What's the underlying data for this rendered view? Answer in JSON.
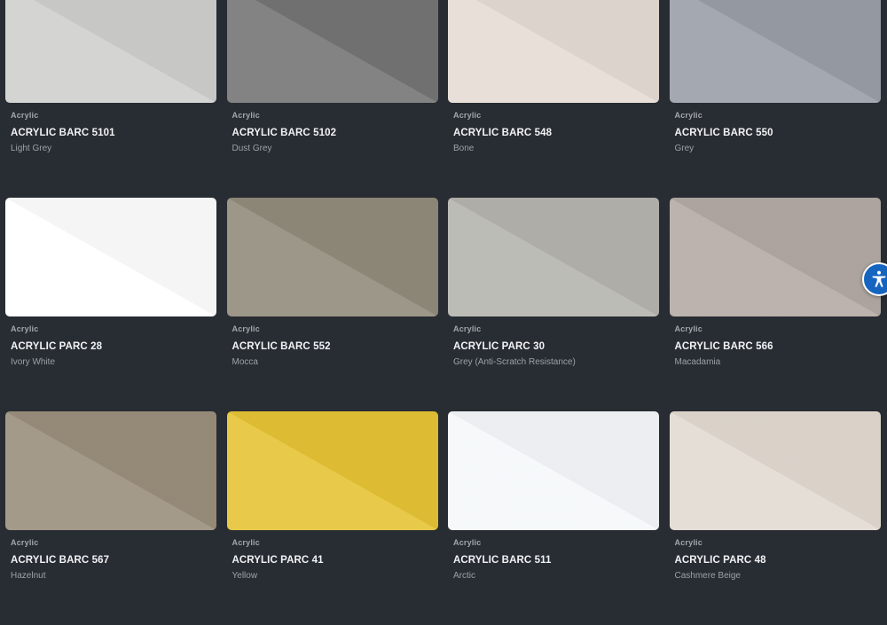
{
  "products": [
    {
      "category": "Acrylic",
      "code": "ACRYLIC BARC 5101",
      "name": "Light Grey",
      "color": "#cfcfcd"
    },
    {
      "category": "Acrylic",
      "code": "ACRYLIC BARC 5102",
      "name": "Dust Grey",
      "color": "#757575"
    },
    {
      "category": "Acrylic",
      "code": "ACRYLIC BARC 548",
      "name": "Bone",
      "color": "#e5ddd4"
    },
    {
      "category": "Acrylic",
      "code": "ACRYLIC BARC 550",
      "name": "Grey",
      "color": "#9a9ea7"
    },
    {
      "category": "Acrylic",
      "code": "ACRYLIC PARC 28",
      "name": "Ivory White",
      "color": "#ffffff"
    },
    {
      "category": "Acrylic",
      "code": "ACRYLIC BARC 552",
      "name": "Mocca",
      "color": "#928b7c"
    },
    {
      "category": "Acrylic",
      "code": "ACRYLIC PARC 30",
      "name": "Grey (Anti-Scratch Resistance)",
      "color": "#b5b4ae"
    },
    {
      "category": "Acrylic",
      "code": "ACRYLIC BARC 566",
      "name": "Macadamia",
      "color": "#b3aaa4"
    },
    {
      "category": "Acrylic",
      "code": "ACRYLIC BARC 567",
      "name": "Hazelnut",
      "color": "#9a8f7c"
    },
    {
      "category": "Acrylic",
      "code": "ACRYLIC PARC 41",
      "name": "Yellow",
      "color": "#e6c335"
    },
    {
      "category": "Acrylic",
      "code": "ACRYLIC BARC 511",
      "name": "Arctic",
      "color": "#f5f8fa"
    },
    {
      "category": "Acrylic",
      "code": "ACRYLIC PARC 48",
      "name": "Cashmere Beige",
      "color": "#e2dad1"
    }
  ],
  "accessibility_button": {
    "icon": "accessibility-icon",
    "color": "#1565c0"
  }
}
